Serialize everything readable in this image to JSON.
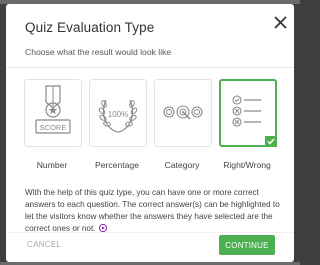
{
  "modal": {
    "title": "Quiz Evaluation Type",
    "subtitle": "Choose what the result would look like",
    "close_icon": "close-icon"
  },
  "options": [
    {
      "label": "Number",
      "icon": "score-badge-icon",
      "icon_text": "SCORE",
      "selected": false
    },
    {
      "label": "Percentage",
      "icon": "laurel-percentage-icon",
      "icon_text": "100%",
      "selected": false
    },
    {
      "label": "Category",
      "icon": "target-category-icon",
      "selected": false
    },
    {
      "label": "Right/Wrong",
      "icon": "checklist-icon",
      "selected": true
    }
  ],
  "description": "With the help of this quiz type, you can have one or more correct answers to each question. The correct answer(s) can be highlighted to let the visitors know whether the answers they have selected are the correct ones or not.",
  "footer": {
    "cancel_label": "CANCEL",
    "continue_label": "CONTINUE"
  },
  "colors": {
    "accent": "#4caf50",
    "icon_gray": "#8a8a8a",
    "backdrop": "#3f3f3f"
  }
}
